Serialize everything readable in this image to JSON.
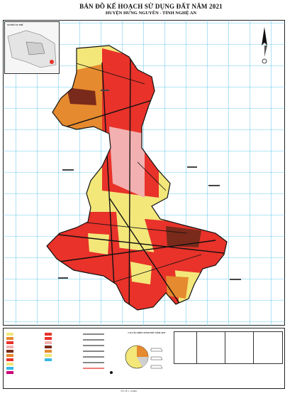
{
  "title": "BẢN ĐỒ KẾ HOẠCH SỬ DỤNG ĐẤT NĂM 2021",
  "subtitle": "HUYỆN HƯNG NGUYÊN - TỈNH NGHỆ AN",
  "inset": {
    "title": "SƠ ĐỒ VỊ TRÍ"
  },
  "legend": {
    "chart_title": "CƠ CẤU DIỆN TÍCH ĐẤT NĂM 2021"
  },
  "scale_text": "TỶ LỆ 1: 25000",
  "colors": {
    "land_orange": "#e58a2e",
    "land_red": "#e8322a",
    "land_yellow": "#f3e77a",
    "land_dark": "#7a2a1a",
    "land_pink": "#f2b0b0",
    "grid": "#38b7e8",
    "road": "#111111"
  }
}
